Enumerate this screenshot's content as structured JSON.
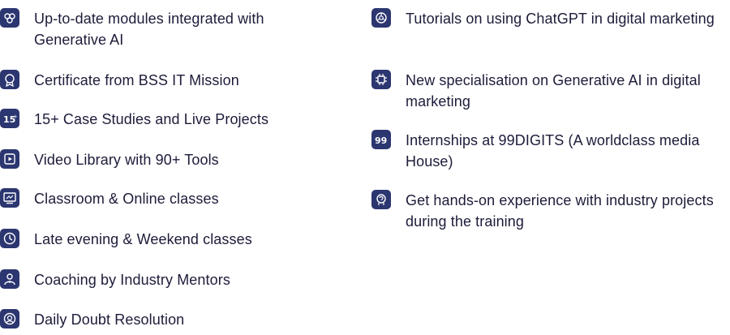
{
  "features_left": [
    {
      "icon": "ai-modules-icon",
      "text": "Up-to-date modules integrated with Generative AI"
    },
    {
      "icon": "certificate-icon",
      "text": "Certificate from BSS IT Mission"
    },
    {
      "icon": "case-studies-15-icon",
      "text": "15+ Case Studies and Live Projects"
    },
    {
      "icon": "video-library-icon",
      "text": "Video Library with 90+ Tools"
    },
    {
      "icon": "classroom-icon",
      "text": "Classroom & Online classes"
    },
    {
      "icon": "clock-icon",
      "text": "Late evening & Weekend classes"
    },
    {
      "icon": "mentor-icon",
      "text": "Coaching by Industry Mentors"
    },
    {
      "icon": "doubt-resolution-icon",
      "text": "Daily Doubt Resolution"
    }
  ],
  "features_right": [
    {
      "icon": "chatgpt-icon",
      "text": "Tutorials on using ChatGPT in digital marketing"
    },
    {
      "icon": "ai-chip-icon",
      "text": "New specialisation on Generative AI in digital marketing"
    },
    {
      "icon": "99digits-icon",
      "text": "Internships at 99DIGITS (A worldclass media House)"
    },
    {
      "icon": "hands-on-icon",
      "text": "Get hands-on experience with industry projects during the training"
    }
  ],
  "colors": {
    "icon_bg": "#2c3670",
    "icon_fg": "#ffffff",
    "text": "#1c1c3a"
  }
}
